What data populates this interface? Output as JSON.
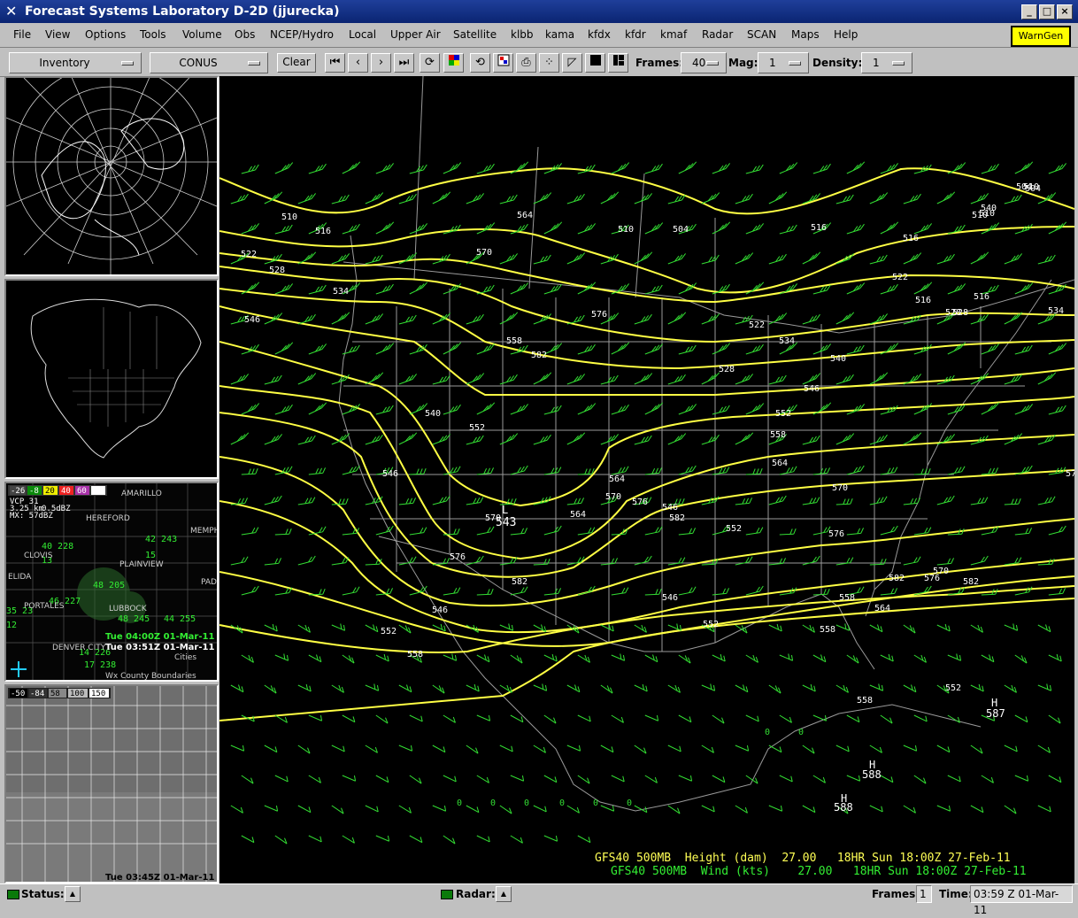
{
  "window": {
    "title": "Forecast Systems Laboratory D-2D (jjurecka)"
  },
  "menus": [
    "File",
    "View",
    "Options",
    "Tools",
    "Volume",
    "Obs",
    "NCEP/Hydro",
    "Local",
    "Upper Air",
    "Satellite",
    "klbb",
    "kama",
    "kfdx",
    "kfdr",
    "kmaf",
    "Radar",
    "SCAN",
    "Maps",
    "Help"
  ],
  "wamgen_label": "WarnGen",
  "toolbar": {
    "inventory": "Inventory",
    "scale": "CONUS",
    "clear": "Clear",
    "frames_label": "Frames:",
    "frames_value": "40",
    "mag_label": "Mag:",
    "mag_value": "1",
    "density_label": "Density:",
    "density_value": "1"
  },
  "panels": {
    "p3": {
      "colorbar": [
        "-26",
        "-8",
        "20",
        "40",
        "60"
      ],
      "info": [
        "VCP 31",
        "3.25 km",
        "0.5dBZ",
        "MX: 57dBZ"
      ],
      "cities": [
        "AMARILLO",
        "HEREFORD",
        "PLAINVIEW",
        "LUBBOCK",
        "CLOVIS",
        "PORTALES",
        "DENVER CITY",
        "ELIDA",
        "MEMPH",
        "PAD"
      ],
      "obs": [
        "40 228",
        "42 243",
        "13",
        "15",
        "48 205",
        "46 227",
        "48 245",
        "44 255",
        "35 23",
        "12",
        "14 226",
        "17 238"
      ],
      "time1": "Tue 04:00Z 01-Mar-11",
      "time2": "Tue 03:51Z 01-Mar-11",
      "layer1": "Cities",
      "layer2": "Wx County Boundaries"
    },
    "p4": {
      "colorbar": [
        "-50",
        "-84",
        "58",
        "100",
        "150"
      ],
      "time": "Tue 03:45Z 01-Mar-11"
    }
  },
  "contours": {
    "labels": [
      "510",
      "516",
      "522",
      "528",
      "534",
      "546",
      "540",
      "546",
      "552",
      "558",
      "564",
      "570",
      "576",
      "582",
      "504",
      "510",
      "516",
      "522",
      "528",
      "534",
      "540",
      "546",
      "552",
      "558",
      "564",
      "570",
      "576",
      "582",
      "516",
      "510",
      "504",
      "510",
      "516",
      "522",
      "528",
      "534",
      "540",
      "546",
      "552",
      "558",
      "564",
      "570",
      "576",
      "582",
      "546",
      "552",
      "558",
      "552",
      "558",
      "564",
      "570",
      "576",
      "582",
      "546",
      "552",
      "558",
      "564",
      "570",
      "576",
      "582",
      "57",
      "504",
      "510",
      "516",
      "528"
    ],
    "low_value": "543",
    "high_labels": [
      "587",
      "588",
      "588"
    ],
    "zero_labels": [
      "0",
      "0",
      "0",
      "0",
      "0",
      "0",
      "0",
      "0"
    ]
  },
  "legend": {
    "line1": "GFS40 500MB  Height (dam)  27.00   18HR Sun 18:00Z 27-Feb-11",
    "line2": "GFS40 500MB  Wind (kts)    27.00   18HR Sun 18:00Z 27-Feb-11"
  },
  "statusbar": {
    "status_label": "Status:",
    "radar_label": "Radar:",
    "frames_label": "Frames:",
    "frames_value": "1",
    "time_label": "Time:",
    "time_value": "03:59 Z 01-Mar-11"
  },
  "colors": {
    "contour": "#ffff44",
    "barb": "#33dd33",
    "borders": "#9a9a9a",
    "titlebar": "#0a2472",
    "wamgen": "#ffff00"
  },
  "icons": [
    "x-logo-icon",
    "minimize-icon",
    "maximize-icon",
    "close-icon",
    "first-frame-icon",
    "prev-frame-icon",
    "next-frame-icon",
    "last-frame-icon",
    "loop-icon",
    "colormap-icon",
    "refresh-icon",
    "image-icon",
    "print-icon",
    "points-icon",
    "baseline-icon",
    "single-panel-icon",
    "four-panel-icon"
  ]
}
